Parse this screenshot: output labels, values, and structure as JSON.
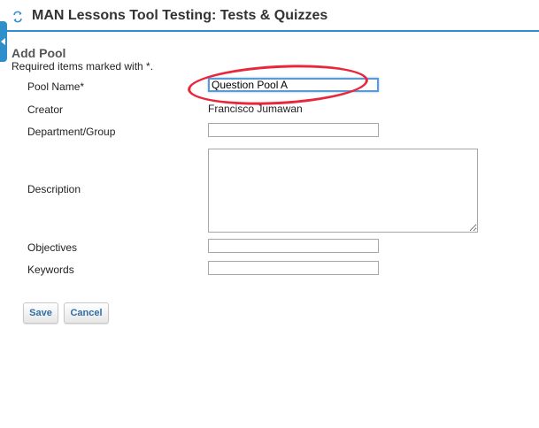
{
  "header": {
    "title": "MAN Lessons Tool Testing: Tests & Quizzes",
    "icon": "refresh-arrows-icon"
  },
  "side_tab": {
    "icon": "collapse-left-arrow-icon",
    "color": "#2f8fca"
  },
  "form": {
    "section_title": "Add Pool",
    "required_note": "Required items marked with *.",
    "pool_name": {
      "label": "Pool Name*",
      "value": "Question Pool A"
    },
    "creator": {
      "label": "Creator",
      "value": "Francisco Jumawan"
    },
    "department": {
      "label": "Department/Group",
      "value": ""
    },
    "description": {
      "label": "Description",
      "value": ""
    },
    "objectives": {
      "label": "Objectives",
      "value": ""
    },
    "keywords": {
      "label": "Keywords",
      "value": ""
    }
  },
  "buttons": {
    "save_label": "Save",
    "cancel_label": "Cancel"
  },
  "colors": {
    "accent": "#2f8fca",
    "annotation": "#e8263c",
    "button_text": "#2f6ea5"
  }
}
